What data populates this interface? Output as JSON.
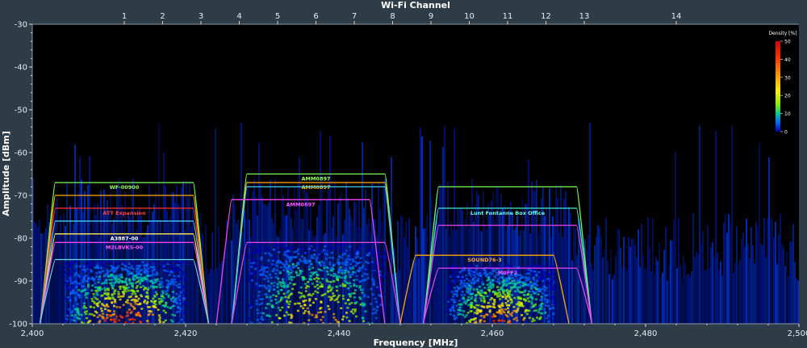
{
  "chart_data": {
    "type": "heatmap",
    "subtype": "wifi-spectrum-density",
    "top_axis_title": "Wi-Fi Channel",
    "channels": [
      "1",
      "2",
      "3",
      "4",
      "5",
      "6",
      "7",
      "8",
      "9",
      "10",
      "11",
      "12",
      "13",
      "14"
    ],
    "channel_freqs_mhz": [
      2412,
      2417,
      2422,
      2427,
      2432,
      2437,
      2442,
      2447,
      2452,
      2457,
      2462,
      2467,
      2472,
      2484
    ],
    "xlabel": "Frequency [MHz]",
    "xlim": [
      2400,
      2500
    ],
    "x_ticks": [
      2400,
      2420,
      2440,
      2460,
      2480,
      2500
    ],
    "x_tick_labels": [
      "2,400",
      "2,420",
      "2,440",
      "2,460",
      "2,480",
      "2,500"
    ],
    "ylabel": "Amplitude [dBm]",
    "ylim": [
      -100,
      -30
    ],
    "y_ticks": [
      -100,
      -90,
      -80,
      -70,
      -60,
      -50,
      -40,
      -30
    ],
    "y_tick_labels": [
      "-100",
      "-90",
      "-80",
      "-70",
      "-60",
      "-50",
      "-40",
      "-30"
    ],
    "legend": {
      "title": "Density [%]",
      "placement": "top-right",
      "ticks": [
        "50",
        "40",
        "30",
        "20",
        "10",
        "0"
      ],
      "tick_values": [
        50,
        40,
        30,
        20,
        10,
        0
      ],
      "colors": [
        "#cc0000",
        "#ff3300",
        "#ff9900",
        "#ffee00",
        "#88ee00",
        "#00cc99",
        "#0066ff",
        "#0000aa"
      ]
    },
    "density_clusters": [
      {
        "range_mhz": [
          2404,
          2420
        ],
        "peak_density": 50,
        "top_dbm": -85
      },
      {
        "range_mhz": [
          2428,
          2446
        ],
        "peak_density": 40,
        "top_dbm": -81
      },
      {
        "range_mhz": [
          2454,
          2468
        ],
        "peak_density": 45,
        "top_dbm": -86
      }
    ],
    "networks": [
      {
        "label": "WF-00900",
        "center_mhz": 2412,
        "peak_dbm": -67,
        "color": "#77ff55",
        "label_color": "#99ff66"
      },
      {
        "label": "",
        "center_mhz": 2412,
        "peak_dbm": -70,
        "color": "#ffaa00",
        "label_color": "#ffaa00"
      },
      {
        "label": "ATT Expansion",
        "center_mhz": 2412,
        "peak_dbm": -73,
        "color": "#ff3333",
        "label_color": "#ff4444"
      },
      {
        "label": "",
        "center_mhz": 2412,
        "peak_dbm": -76,
        "color": "#44ccff",
        "label_color": "#44ccff"
      },
      {
        "label": "A3887-00",
        "center_mhz": 2412,
        "peak_dbm": -79,
        "color": "#ffee55",
        "label_color": "#ffffff"
      },
      {
        "label": "M2LBVKS-00",
        "center_mhz": 2412,
        "peak_dbm": -81,
        "color": "#ee44ee",
        "label_color": "#ff55ff"
      },
      {
        "label": "",
        "center_mhz": 2412,
        "peak_dbm": -85,
        "color": "#66dddd",
        "label_color": "#66dddd"
      },
      {
        "label": "AMM0897",
        "center_mhz": 2437,
        "peak_dbm": -65,
        "color": "#77ff55",
        "label_color": "#99ff66"
      },
      {
        "label": "AMM0897",
        "center_mhz": 2437,
        "peak_dbm": -67,
        "color": "#ffaa00",
        "label_color": "#ffcc00"
      },
      {
        "label": "",
        "center_mhz": 2437,
        "peak_dbm": -68,
        "color": "#44ccff",
        "label_color": "#44ccff"
      },
      {
        "label": "AMM0897",
        "center_mhz": 2435,
        "peak_dbm": -71,
        "color": "#ee44ee",
        "label_color": "#ff55ff"
      },
      {
        "label": "",
        "center_mhz": 2437,
        "peak_dbm": -81,
        "color": "#dd44dd",
        "label_color": "#dd44dd"
      },
      {
        "label": "",
        "center_mhz": 2462,
        "peak_dbm": -68,
        "color": "#77ff55",
        "label_color": "#99ff66"
      },
      {
        "label": "Lunt Fontanne Box Office",
        "center_mhz": 2462,
        "peak_dbm": -73,
        "color": "#44eecc",
        "label_color": "#66ffee"
      },
      {
        "label": "",
        "center_mhz": 2462,
        "peak_dbm": -77,
        "color": "#ee44ee",
        "label_color": "#ff55ff"
      },
      {
        "label": "SOUND76-3",
        "center_mhz": 2459,
        "peak_dbm": -84,
        "color": "#ffaa00",
        "label_color": "#ffaa44"
      },
      {
        "label": "M0FF2",
        "center_mhz": 2462,
        "peak_dbm": -87,
        "color": "#ee44ee",
        "label_color": "#ff55ff"
      }
    ]
  }
}
